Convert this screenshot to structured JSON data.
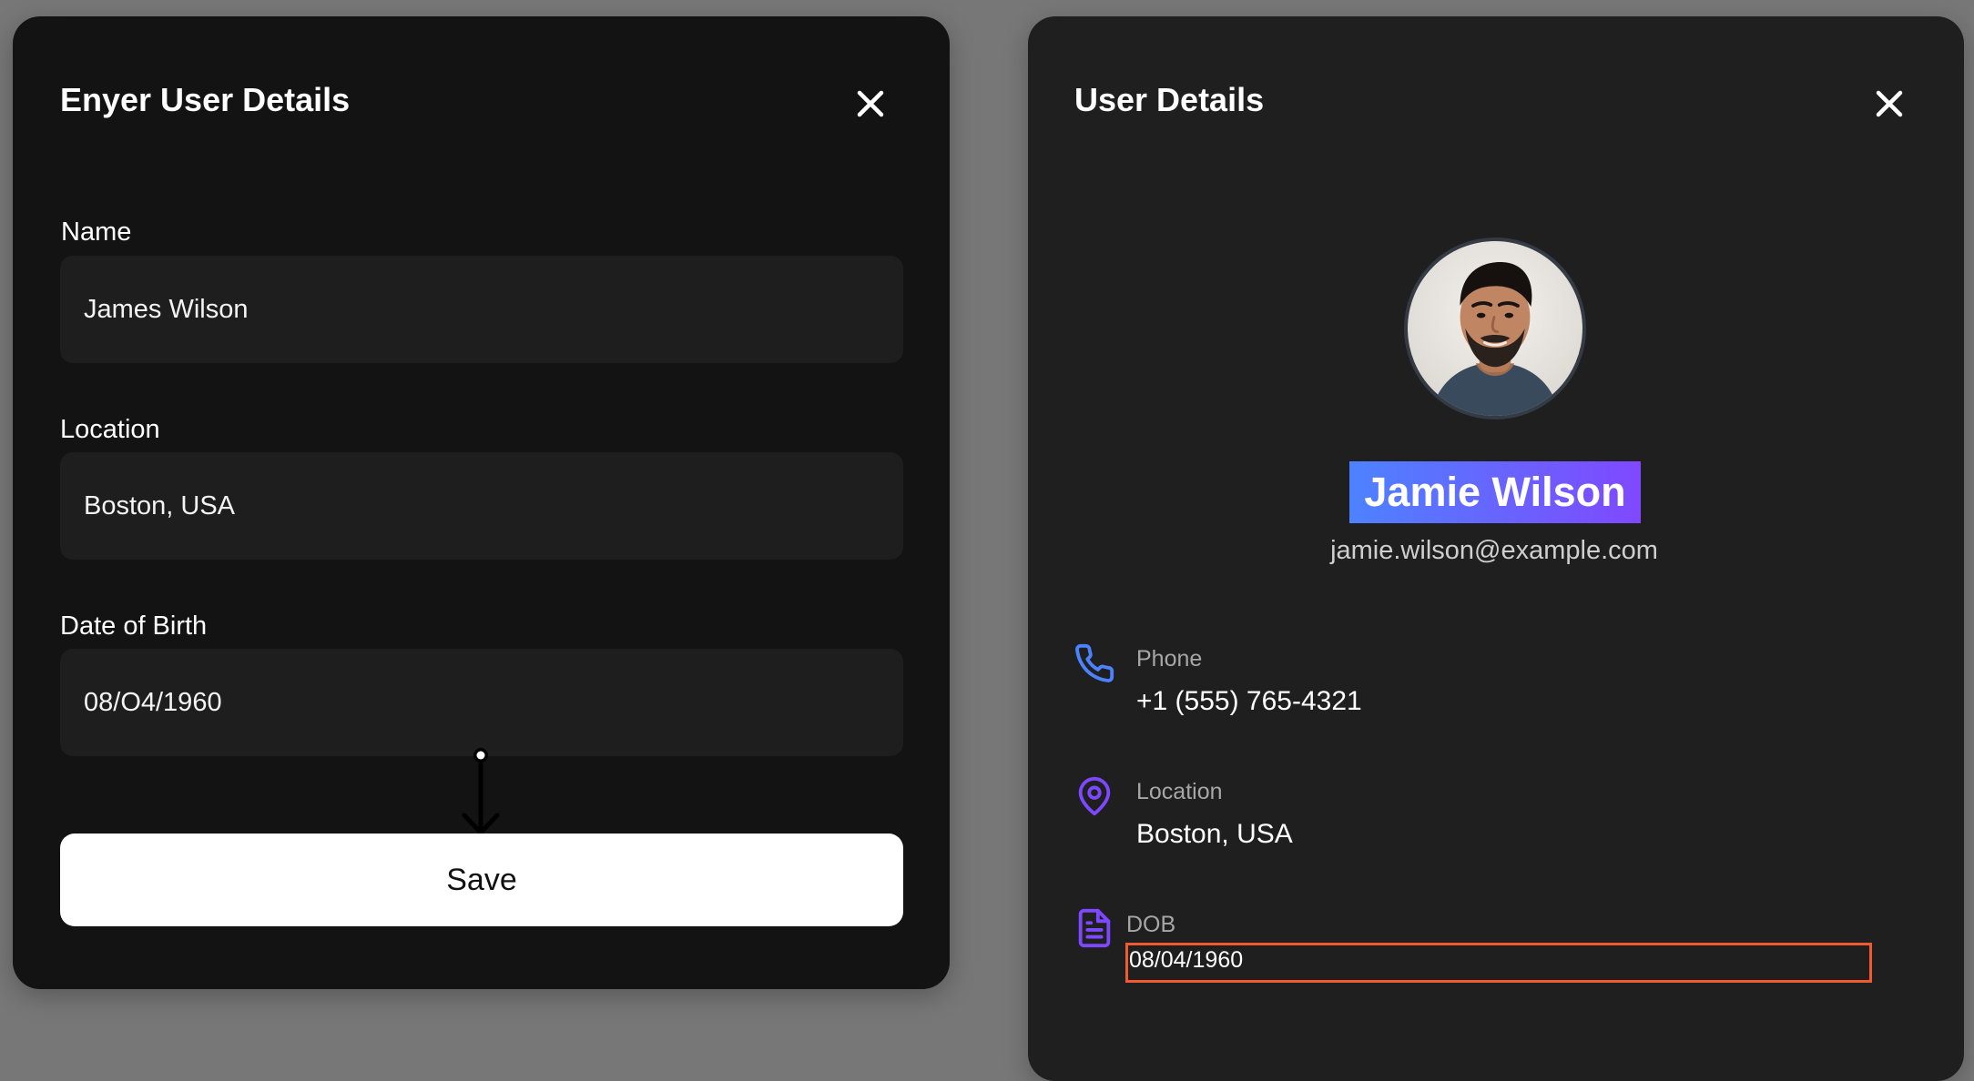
{
  "left_modal": {
    "title": "Enyer User Details",
    "fields": [
      {
        "label": "Name",
        "value": "James Wilson"
      },
      {
        "label": "Location",
        "value": "Boston, USA"
      },
      {
        "label": "Date of Birth",
        "value": "08/O4/1960"
      }
    ],
    "save_label": "Save"
  },
  "right_modal": {
    "title": "User Details",
    "name": "Jamie Wilson",
    "email": "jamie.wilson@example.com",
    "details": [
      {
        "label": "Phone",
        "value": "+1 (555) 765-4321",
        "icon": "phone-icon",
        "color": "#4d82ff"
      },
      {
        "label": "Location",
        "value": "Boston, USA",
        "icon": "location-pin-icon",
        "color": "#7d48ff"
      },
      {
        "label": "DOB",
        "value": "08/04/1960",
        "icon": "document-icon",
        "color": "#7d48ff"
      }
    ]
  },
  "colors": {
    "background": "#777777",
    "left_modal": "#131313",
    "right_modal": "#1f1f1f",
    "input": "#1e1e1e",
    "accent_blue": "#4d82ff",
    "accent_purple": "#7d48ff",
    "highlight_border": "#ef5a31"
  }
}
